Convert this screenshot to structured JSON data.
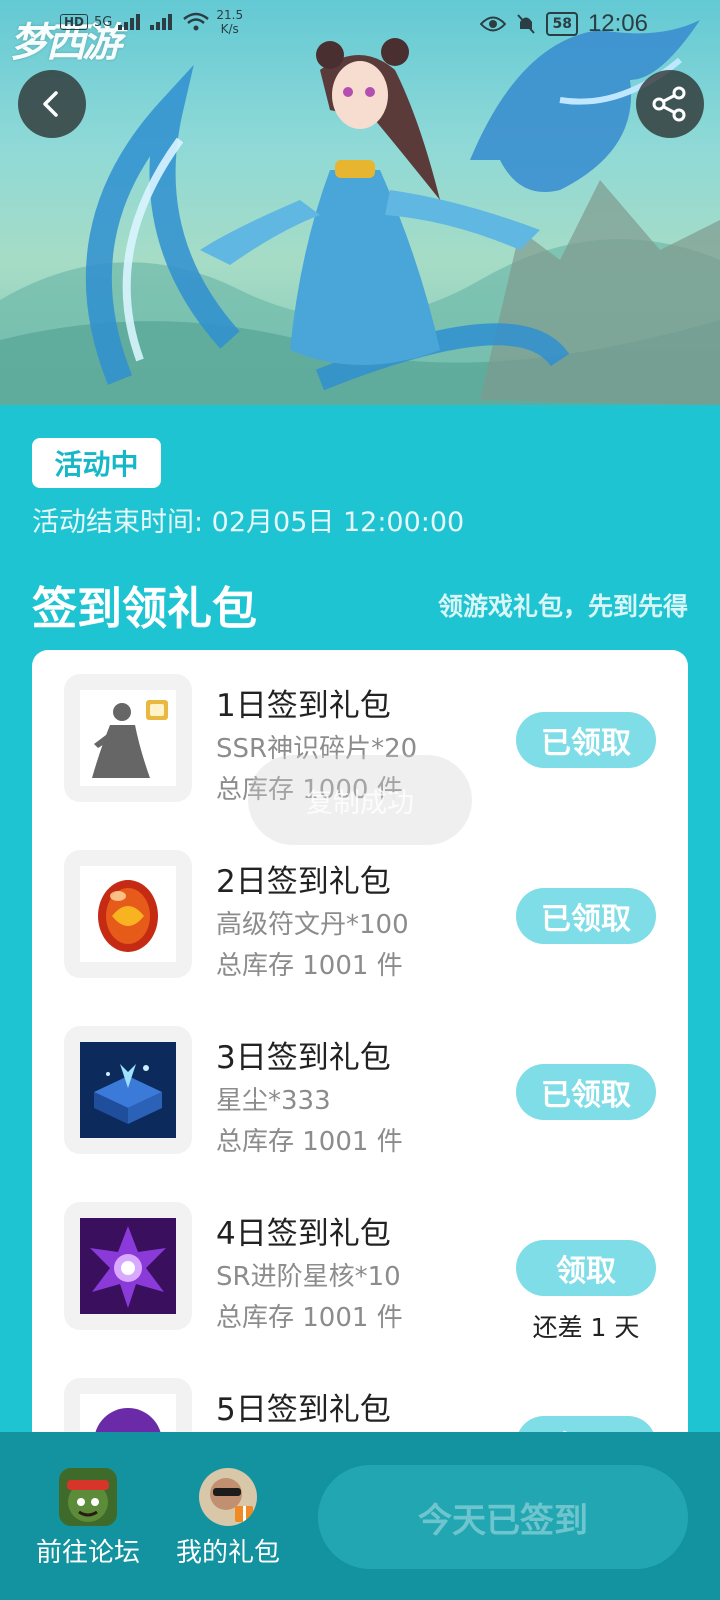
{
  "status_bar": {
    "network_badge": "HD",
    "network_type": "5G",
    "speed_value": "21.5",
    "speed_unit": "K/s",
    "battery": "58",
    "time": "12:06"
  },
  "banner": {
    "logo_text": "梦西游",
    "back_icon": "chevron-left-icon",
    "share_icon": "share-icon"
  },
  "activity": {
    "status_badge": "活动中",
    "end_time": "活动结束时间: 02月05日 12:00:00"
  },
  "section": {
    "title": "签到领礼包",
    "subtitle": "领游戏礼包，先到先得"
  },
  "gifts": [
    {
      "title": "1日签到礼包",
      "item": "SSR神识碎片*20",
      "stock": "总库存 1000 件",
      "button": "已领取",
      "note": ""
    },
    {
      "title": "2日签到礼包",
      "item": "高级符文丹*100",
      "stock": "总库存 1001 件",
      "button": "已领取",
      "note": ""
    },
    {
      "title": "3日签到礼包",
      "item": "星尘*333",
      "stock": "总库存 1001 件",
      "button": "已领取",
      "note": ""
    },
    {
      "title": "4日签到礼包",
      "item": "SR进阶星核*10",
      "stock": "总库存 1001 件",
      "button": "领取",
      "note": "还差 1 天"
    },
    {
      "title": "5日签到礼包",
      "item": "",
      "stock": "",
      "button": "领取",
      "note": ""
    }
  ],
  "toast": "复制成功",
  "bottom_bar": {
    "forum_label": "前往论坛",
    "my_gifts_label": "我的礼包",
    "checkin_button": "今天已签到"
  },
  "colors": {
    "page_background": "#1fc4d2",
    "bottom_bar": "#12939f",
    "claim_button": "#7edde6",
    "badge_text": "#16b8c7"
  }
}
